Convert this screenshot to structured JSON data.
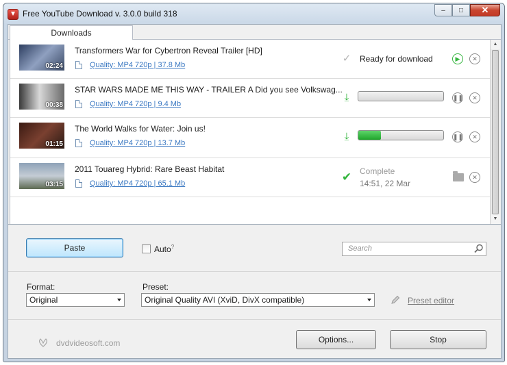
{
  "window": {
    "title": "Free YouTube Download  v. 3.0.0 build 318",
    "controls": {
      "minimize": "‒",
      "maximize": "□",
      "close": "✕"
    }
  },
  "tabs": [
    {
      "label": "Downloads"
    }
  ],
  "downloads": [
    {
      "title": "Transformers War for Cybertron Reveal Trailer [HD]",
      "duration": "02:24",
      "quality": "Quality: MP4   720p | 37.8 Mb",
      "state": "ready",
      "status_text": "Ready for download",
      "thumb_color": "#556688"
    },
    {
      "title": "STAR WARS MADE ME THIS WAY - TRAILER A    Did you see Volkswag...",
      "duration": "00:38",
      "quality": "Quality: MP4   720p | 9.4 Mb",
      "state": "downloading",
      "progress": 0.0,
      "thumb_color": "#8a8a8a"
    },
    {
      "title": "The World Walks for Water: Join us!",
      "duration": "01:15",
      "quality": "Quality: MP4   720p | 13.7 Mb",
      "state": "downloading",
      "progress": 0.27,
      "thumb_color": "#4a2a20"
    },
    {
      "title": "2011 Touareg Hybrid: Rare Beast Habitat",
      "duration": "03:15",
      "quality": "Quality: MP4   720p | 65.1 Mb",
      "state": "complete",
      "status_text": "Complete",
      "complete_time": "14:51, 22 Mar",
      "thumb_color": "#9aa6b2"
    }
  ],
  "controls": {
    "paste_label": "Paste",
    "auto_label": "Auto",
    "auto_help": "?",
    "auto_checked": false,
    "search_placeholder": "Search"
  },
  "format": {
    "label": "Format:",
    "value": "Original"
  },
  "preset": {
    "label": "Preset:",
    "value": "Original Quality AVI (XviD, DivX compatible)"
  },
  "preset_editor_label": "Preset editor",
  "footer": {
    "brand": "dvdvideosoft.com",
    "options_label": "Options...",
    "stop_label": "Stop"
  },
  "colors": {
    "accent_green": "#33b53d",
    "link_blue": "#3a78c2"
  }
}
